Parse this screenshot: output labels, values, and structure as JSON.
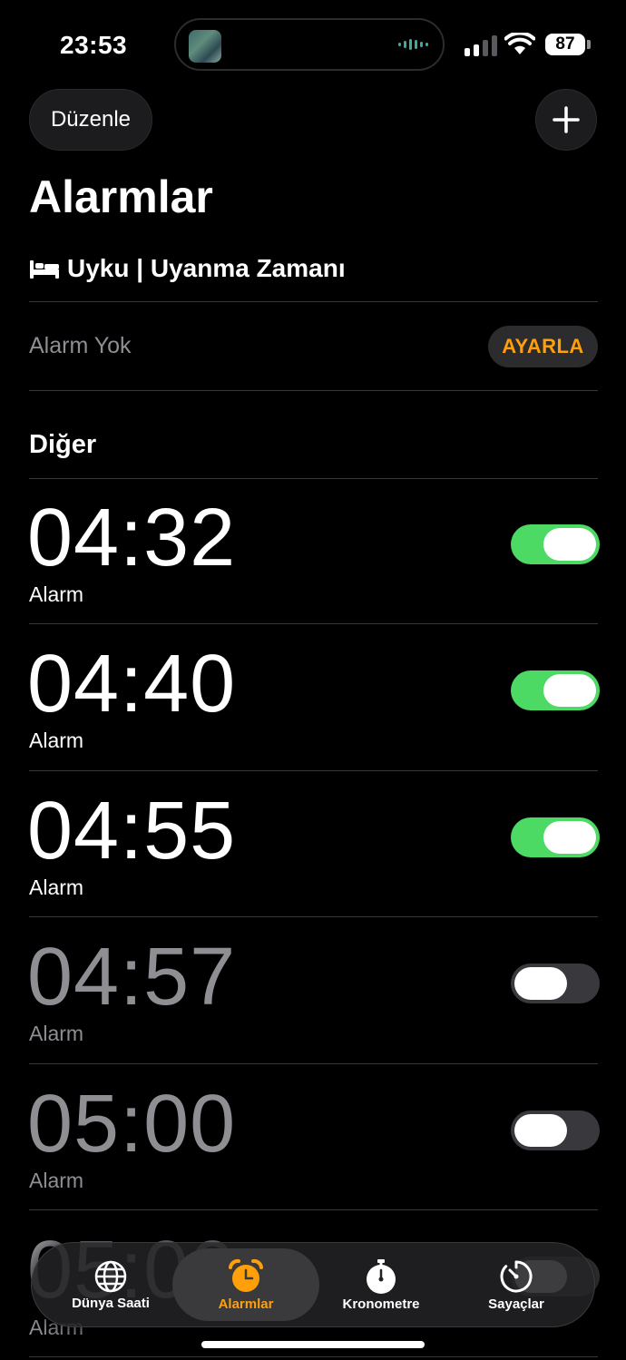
{
  "status_bar": {
    "time": "23:53",
    "battery": "87"
  },
  "header": {
    "edit_label": "Düzenle",
    "title": "Alarmlar"
  },
  "sleep": {
    "title": "Uyku | Uyanma Zamanı",
    "status": "Alarm Yok",
    "set_label": "AYARLA"
  },
  "section_other": "Diğer",
  "alarms": [
    {
      "time": "04:32",
      "label": "Alarm",
      "enabled": true
    },
    {
      "time": "04:40",
      "label": "Alarm",
      "enabled": true
    },
    {
      "time": "04:55",
      "label": "Alarm",
      "enabled": true
    },
    {
      "time": "04:57",
      "label": "Alarm",
      "enabled": false
    },
    {
      "time": "05:00",
      "label": "Alarm",
      "enabled": false
    },
    {
      "time": "05:00",
      "label": "Alarm",
      "enabled": false
    }
  ],
  "tabs": [
    {
      "label": "Dünya Saati",
      "icon": "globe-icon"
    },
    {
      "label": "Alarmlar",
      "icon": "alarm-clock-icon",
      "active": true
    },
    {
      "label": "Kronometre",
      "icon": "stopwatch-icon"
    },
    {
      "label": "Sayaçlar",
      "icon": "timer-icon"
    }
  ],
  "colors": {
    "accent": "#ff9f0a",
    "toggle_on": "#4cd964",
    "background": "#000000"
  }
}
